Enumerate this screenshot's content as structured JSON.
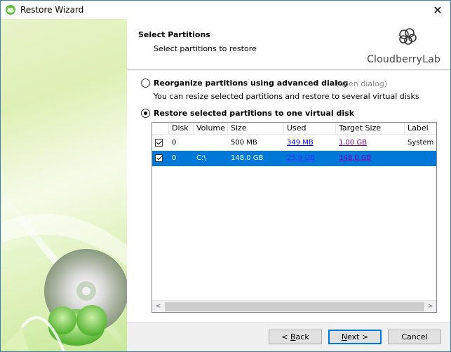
{
  "window": {
    "title": "Restore Wizard",
    "close_glyph": "✕"
  },
  "header": {
    "title": "Select Partitions",
    "subtitle": "Select partitions to restore",
    "logo_text": "CloudberryLab"
  },
  "options": [
    {
      "label": "Reorganize partitions using advanced dialog",
      "link": "(open dialog)",
      "description": "You can resize selected partitions and restore to several virtual disks",
      "checked": false
    },
    {
      "label": "Restore selected partitions to one virtual disk",
      "checked": true
    }
  ],
  "table": {
    "columns": [
      "",
      "Disk",
      "Volume",
      "Size",
      "Used",
      "Target Size",
      "Label"
    ],
    "rows": [
      {
        "checked": true,
        "disk": "0",
        "volume": "",
        "size": "500 MB",
        "used": "349 MB",
        "target_size": "1.00 GB",
        "label": "System",
        "selected": false
      },
      {
        "checked": true,
        "disk": "0",
        "volume": "C:\\",
        "size": "148.0 GB",
        "used": "25.9 GB",
        "target_size": "148.0 GB",
        "label": "",
        "selected": true
      }
    ]
  },
  "scrollbar": {
    "left_arrow": "<",
    "right_arrow": ">"
  },
  "buttons": {
    "back": {
      "prefix": "< ",
      "mnemonic": "B",
      "rest": "ack"
    },
    "next": {
      "mnemonic": "N",
      "rest": "ext >"
    },
    "cancel": "Cancel"
  },
  "colors": {
    "selection": "#0078d7",
    "link": "#0000ee",
    "visited_link": "#800080",
    "accent_green": "#6cbf3a"
  },
  "icons": {
    "app": "cloudberry-app-icon",
    "logo": "cloudberry-logo-icon",
    "disc": "cd-disc-icon"
  }
}
